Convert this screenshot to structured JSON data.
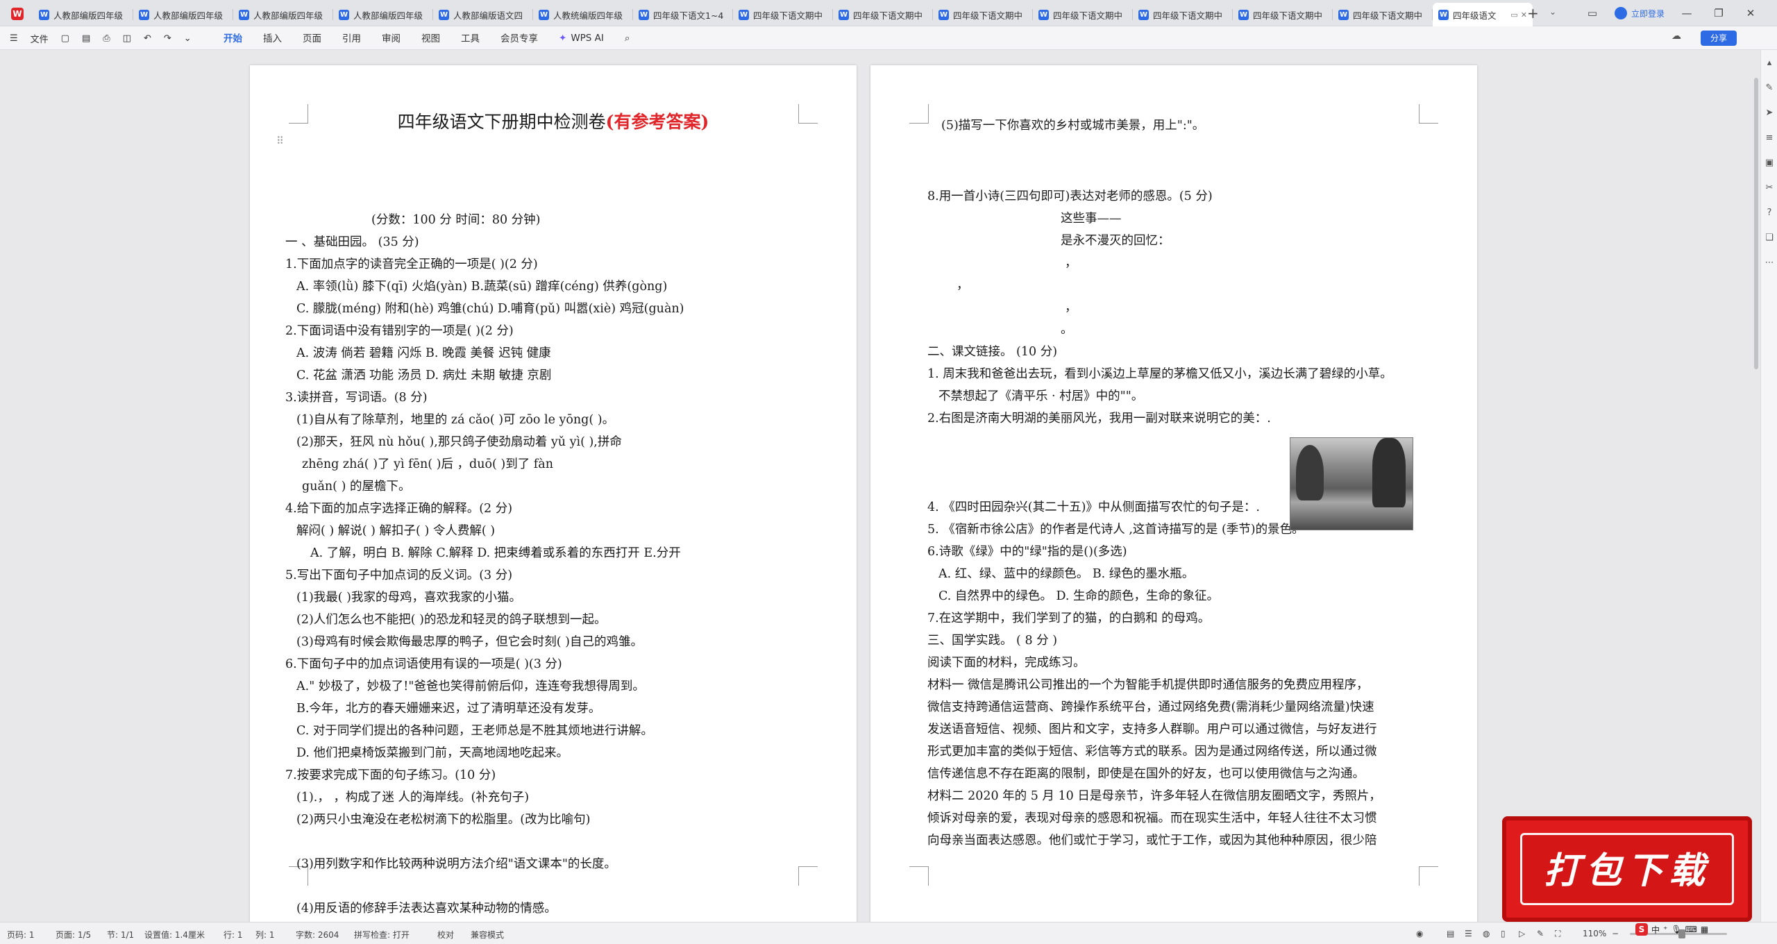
{
  "titlebar": {
    "app_logo": "wps-logo-icon",
    "tabs": [
      {
        "label": "人教部编版四年级",
        "active": false
      },
      {
        "label": "人教部编版四年级",
        "active": false
      },
      {
        "label": "人教部编版四年级",
        "active": false
      },
      {
        "label": "人教部编版四年级",
        "active": false
      },
      {
        "label": "人教部编版语文四",
        "active": false
      },
      {
        "label": "人教统编版四年级",
        "active": false
      },
      {
        "label": "四年级下语文1~4",
        "active": false
      },
      {
        "label": "四年级下语文期中",
        "active": false
      },
      {
        "label": "四年级下语文期中",
        "active": false
      },
      {
        "label": "四年级下语文期中",
        "active": false
      },
      {
        "label": "四年级下语文期中",
        "active": false
      },
      {
        "label": "四年级下语文期中",
        "active": false
      },
      {
        "label": "四年级下语文期中",
        "active": false
      },
      {
        "label": "四年级下语文期中",
        "active": false
      },
      {
        "label": "四年级语文",
        "active": true
      }
    ],
    "new_tab": "+",
    "login": "立即登录",
    "tab_badge": "W"
  },
  "ribbon": {
    "file_menu": "文件",
    "menus": [
      "开始",
      "插入",
      "页面",
      "引用",
      "审阅",
      "视图",
      "工具",
      "会员专享"
    ],
    "active_menu": "开始",
    "wps_ai": "WPS AI",
    "share": "分享"
  },
  "page1": {
    "title_main": "四年级语文下册期中检测卷",
    "title_red": "(有参考答案)",
    "lines": [
      {
        "text": "(分数：100 分      时间：80 分钟)"
      },
      {
        "text": "一 、基础田园。 (35 分)"
      },
      {
        "text": "1.下面加点字的读音完全正确的一项是(      )(2 分)"
      },
      {
        "text": "A.  率领(lǜ)     膝下(qī)     火焰(yàn)       B.蔬菜(sū)  蹭痒(céng)  供养(gòng)"
      },
      {
        "text": "C.  朦胧(méng)    附和(hè)    鸡雏(chú)        D.哺育(pǔ)  叫嚣(xiè)   鸡冠(guàn)"
      },
      {
        "text": "2.下面词语中没有错别字的一项是(      )(2 分)"
      },
      {
        "text": "A.  波涛      倘若      碧籍      闪烁    B.  晚霞      美餐      迟钝      健康"
      },
      {
        "text": "C.  花盆      潇洒      功能      汤员    D.  病灶      未期      敏捷      京剧"
      },
      {
        "text": "3.读拼音，写词语。(8 分)"
      },
      {
        "text": "(1)自从有了除草剂，地里的 zá cǎo(              )可  zōo le yōng(                 )。"
      },
      {
        "text": "(2)那天，狂风  nù hǒu(                 ),那只鸽子使劲扇动着  yǔ yì(              ),拼命"
      },
      {
        "text": "zhēng    zhá(            )了  yì fēn(            )后 ，duō(            )到了  fàn"
      },
      {
        "text": "guǎn(            ) 的屋檐下。"
      },
      {
        "text": "4.给下面的加点字选择正确的解释。(2 分)"
      },
      {
        "text": "解闷(      )       解说(      )       解扣子(      )       令人费解(   )"
      },
      {
        "text": "A. 了解，明白     B. 解除     C.解释     D. 把束缚着或系着的东西打开       E.分开"
      },
      {
        "text": "5.写出下面句子中加点词的反义词。(3 分)"
      },
      {
        "text": "(1)我最(              )我家的母鸡，喜欢我家的小猫。"
      },
      {
        "text": "(2)人们怎么也不能把(              )的恐龙和轻灵的鸽子联想到一起。"
      },
      {
        "text": "(3)母鸡有时候会欺侮最忠厚的鸭子，但它会时刻(              )自己的鸡雏。"
      },
      {
        "text": "6.下面句子中的加点词语使用有误的一项是(      )(3 分)"
      },
      {
        "text": "A.\" 妙极了，妙极了!\"爸爸也笑得前俯后仰，连连夸我想得周到。"
      },
      {
        "text": "B.今年，北方的春天姗姗来迟，过了清明草还没有发芽。"
      },
      {
        "text": "C.  对于同学们提出的各种问题，王老师总是不胜其烦地进行讲解。"
      },
      {
        "text": "D.  他们把桌椅饭菜搬到门前，天高地阔地吃起来。"
      },
      {
        "text": "7.按要求完成下面的句子练习。(10 分)"
      },
      {
        "text": "(1).，  ，构成了迷  人的海岸线。(补充句子)"
      },
      {
        "text": "(2)两只小虫淹没在老松树滴下的松脂里。(改为比喻句)"
      },
      {
        "text": "(3)用列数字和作比较两种说明方法介绍\"语文课本\"的长度。"
      },
      {
        "text": "(4)用反语的修辞手法表达喜欢某种动物的情感。"
      }
    ]
  },
  "page2": {
    "lines": [
      {
        "text": "(5)描写一下你喜欢的乡村或城市美景，用上\":\"。"
      },
      {
        "text": "8.用一首小诗(三四句即可)表达对老师的感恩。(5 分)"
      },
      {
        "text": "这些事——"
      },
      {
        "text": "是永不漫灭的回忆："
      },
      {
        "text": "，"
      },
      {
        "text": "，"
      },
      {
        "text": "，"
      },
      {
        "text": "。"
      },
      {
        "text": "二、课文链接。 (10 分)"
      },
      {
        "text": "1. 周末我和爸爸出去玩，看到小溪边上草屋的茅檐又低又小，溪边长满了碧绿的小草。"
      },
      {
        "text": "不禁想起了《清平乐 · 村居》中的\"\"。"
      },
      {
        "text": "2.右图是济南大明湖的美丽风光，我用一副对联来说明它的美：."
      },
      {
        "text": "4. 《四时田园杂兴(其二十五)》中从侧面描写农忙的句子是：."
      },
      {
        "text": "5. 《宿新市徐公店》的作者是代诗人 ,这首诗描写的是  (季节)的景色。"
      },
      {
        "text": "6.诗歌《绿》中的\"绿\"指的是()(多选)"
      },
      {
        "text": "A. 红、绿、蓝中的绿颜色。     B. 绿色的墨水瓶。"
      },
      {
        "text": "C. 自然界中的绿色。     D. 生命的颜色，生命的象征。"
      },
      {
        "text": "7.在这学期中，我们学到了的猫，的白鹅和                    的母鸡。"
      },
      {
        "text": "三、国学实践。 ( 8  分 )"
      },
      {
        "text": "阅读下面的材料，完成练习。"
      },
      {
        "text": "材料一    微信是腾讯公司推出的一个为智能手机提供即时通信服务的免费应用程序，"
      },
      {
        "text": "微信支持跨通信运营商、跨操作系统平台，通过网络免费(需消耗少量网络流量)快速"
      },
      {
        "text": "发送语音短信、视频、图片和文字，支持多人群聊。用户可以通过微信，与好友进行"
      },
      {
        "text": "形式更加丰富的类似于短信、彩信等方式的联系。因为是通过网络传送，所以通过微"
      },
      {
        "text": "信传递信息不存在距离的限制，即使是在国外的好友，也可以使用微信与之沟通。"
      },
      {
        "text": "材料二    2020 年的 5 月 10 日是母亲节，许多年轻人在微信朋友圈晒文字，秀照片，"
      },
      {
        "text": "倾诉对母亲的爱，表现对母亲的感恩和祝福。而在现实生活中，年轻人往往不太习惯"
      },
      {
        "text": "向母亲当面表达感恩。他们或忙于学习，或忙于工作，或因为其他种种原因，很少陪"
      }
    ]
  },
  "statusbar": {
    "page_code": "页码: 1",
    "page_of": "页面: 1/5",
    "section": "节: 1/1",
    "setting": "设置值: 1.4厘米",
    "row": "行: 1",
    "col": "列: 1",
    "words": "字数: 2604",
    "spellcheck": "拼写检查: 打开",
    "proof": "校对",
    "compat": "兼容模式",
    "zoom": "110%"
  },
  "ime": {
    "lang": "中"
  },
  "banner": {
    "text": "打包下载"
  }
}
